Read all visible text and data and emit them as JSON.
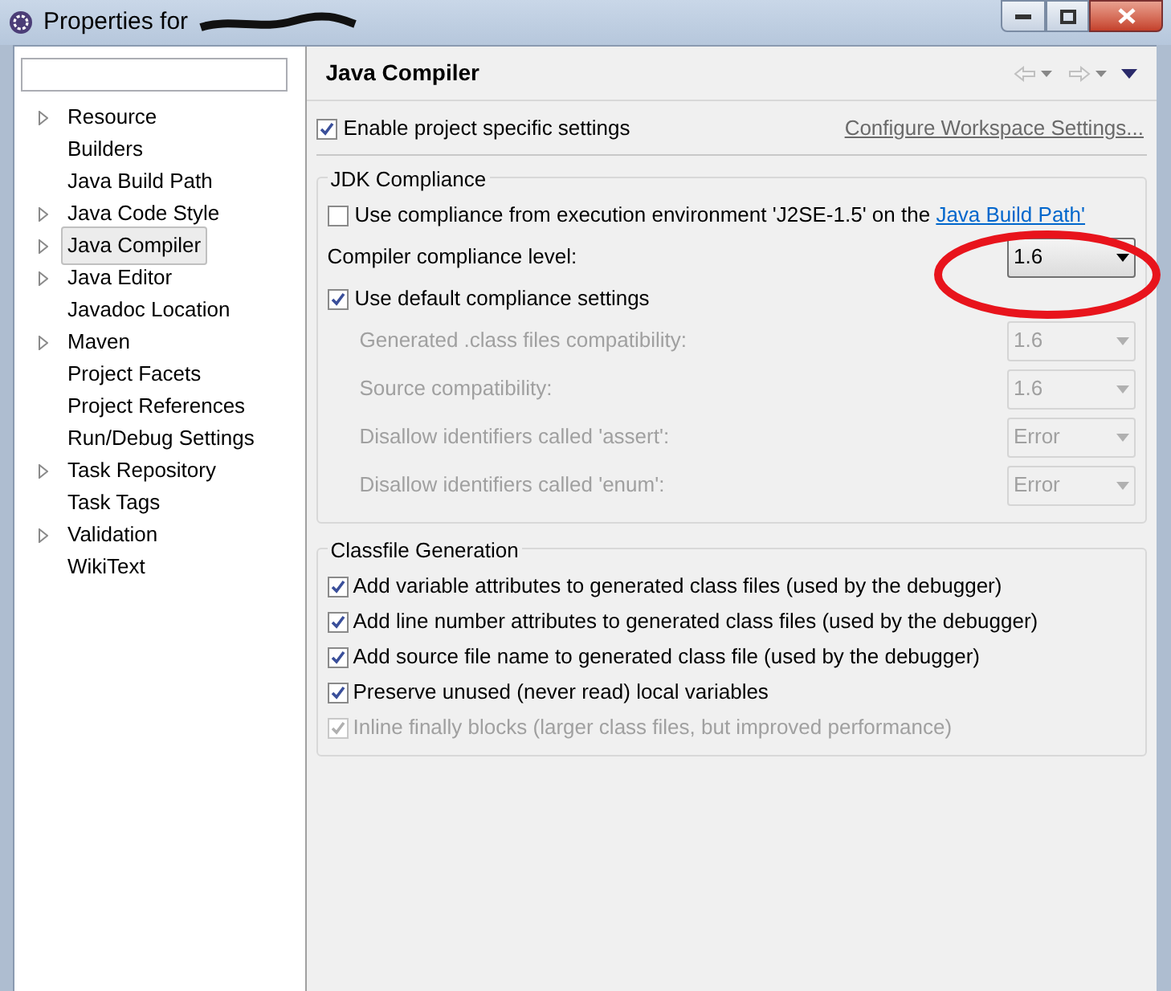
{
  "window": {
    "title": "Properties for"
  },
  "sidebar": {
    "items": [
      {
        "label": "Resource",
        "expandable": true,
        "selected": false
      },
      {
        "label": "Builders",
        "expandable": false,
        "selected": false
      },
      {
        "label": "Java Build Path",
        "expandable": false,
        "selected": false
      },
      {
        "label": "Java Code Style",
        "expandable": true,
        "selected": false
      },
      {
        "label": "Java Compiler",
        "expandable": true,
        "selected": true
      },
      {
        "label": "Java Editor",
        "expandable": true,
        "selected": false
      },
      {
        "label": "Javadoc Location",
        "expandable": false,
        "selected": false
      },
      {
        "label": "Maven",
        "expandable": true,
        "selected": false
      },
      {
        "label": "Project Facets",
        "expandable": false,
        "selected": false
      },
      {
        "label": "Project References",
        "expandable": false,
        "selected": false
      },
      {
        "label": "Run/Debug Settings",
        "expandable": false,
        "selected": false
      },
      {
        "label": "Task Repository",
        "expandable": true,
        "selected": false
      },
      {
        "label": "Task Tags",
        "expandable": false,
        "selected": false
      },
      {
        "label": "Validation",
        "expandable": true,
        "selected": false
      },
      {
        "label": "WikiText",
        "expandable": false,
        "selected": false
      }
    ]
  },
  "page": {
    "title": "Java Compiler",
    "enable": {
      "label": "Enable project specific settings",
      "checked": true
    },
    "configure_link": "Configure Workspace Settings...",
    "jdk": {
      "title": "JDK Compliance",
      "use_ee": {
        "label": "Use compliance from execution environment 'J2SE-1.5' on the ",
        "link": "Java Build Path'",
        "checked": false
      },
      "level": {
        "label": "Compiler compliance level:",
        "value": "1.6"
      },
      "use_default": {
        "label": "Use default compliance settings",
        "checked": true
      },
      "settings": [
        {
          "label": "Generated .class files compatibility:",
          "value": "1.6",
          "disabled": true
        },
        {
          "label": "Source compatibility:",
          "value": "1.6",
          "disabled": true
        },
        {
          "label": "Disallow identifiers called 'assert':",
          "value": "Error",
          "disabled": true
        },
        {
          "label": "Disallow identifiers called 'enum':",
          "value": "Error",
          "disabled": true
        }
      ]
    },
    "classfile": {
      "title": "Classfile Generation",
      "options": [
        {
          "label": "Add variable attributes to generated class files (used by the debugger)",
          "checked": true,
          "disabled": false
        },
        {
          "label": "Add line number attributes to generated class files (used by the debugger)",
          "checked": true,
          "disabled": false
        },
        {
          "label": "Add source file name to generated class file (used by the debugger)",
          "checked": true,
          "disabled": false
        },
        {
          "label": "Preserve unused (never read) local variables",
          "checked": true,
          "disabled": false
        },
        {
          "label": "Inline finally blocks (larger class files, but improved performance)",
          "checked": true,
          "disabled": true
        }
      ]
    }
  }
}
